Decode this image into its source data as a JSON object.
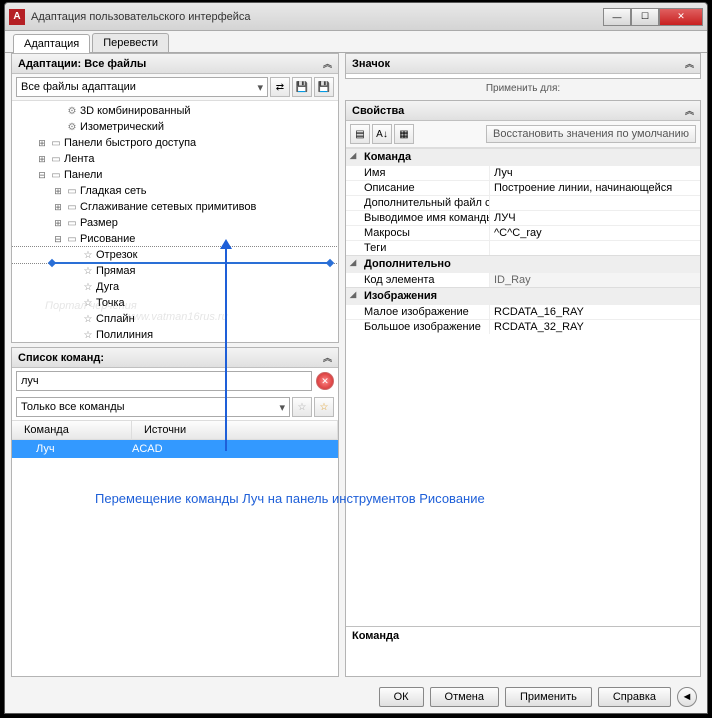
{
  "window": {
    "title": "Адаптация пользовательского интерфейса",
    "app_icon_letter": "A"
  },
  "tabs": {
    "adapt": "Адаптация",
    "translate": "Перевести"
  },
  "adaptations": {
    "header": "Адаптации: Все файлы",
    "combo": "Все файлы адаптации",
    "tree": {
      "combined3d": "3D комбинированный",
      "isometric": "Изометрический",
      "quickaccess": "Панели быстрого доступа",
      "ribbon": "Лента",
      "panels": "Панели",
      "smoothmesh": "Гладкая сеть",
      "netprimitives": "Сглаживание сетевых примитивов",
      "dimension": "Размер",
      "draw": "Рисование",
      "segment": "Отрезок",
      "line": "Прямая",
      "arc": "Дуга",
      "point": "Точка",
      "spline": "Сплайн",
      "polyline": "Полилиния"
    }
  },
  "commandlist": {
    "header": "Список команд:",
    "search_value": "луч",
    "filter": "Только все команды",
    "col_cmd": "Команда",
    "col_src": "Источни",
    "row_cmd": "Луч",
    "row_src": "ACAD"
  },
  "iconpanel": {
    "header": "Значок",
    "apply_for": "Применить для:"
  },
  "properties": {
    "header": "Свойства",
    "restore": "Восстановить значения по умолчанию",
    "cat_command": "Команда",
    "name_k": "Имя",
    "name_v": "Луч",
    "desc_k": "Описание",
    "desc_v": "Построение линии, начинающейся",
    "addfile_k": "Дополнительный файл спр:",
    "addfile_v": "",
    "cmdname_k": "Выводимое имя команды",
    "cmdname_v": "ЛУЧ",
    "macros_k": "Макросы",
    "macros_v": "^C^C_ray",
    "tags_k": "Теги",
    "tags_v": "",
    "cat_extra": "Дополнительно",
    "elemcode_k": "Код элемента",
    "elemcode_v": "ID_Ray",
    "cat_images": "Изображения",
    "small_k": "Малое изображение",
    "small_v": "RCDATA_16_RAY",
    "large_k": "Большое изображение",
    "large_v": "RCDATA_32_RAY",
    "desc_header": "Команда"
  },
  "footer": {
    "ok": "ОК",
    "cancel": "Отмена",
    "apply": "Применить",
    "help": "Справка"
  },
  "annotation": "Перемещение команды Луч на панель инструментов Рисование",
  "watermark1": "Портал черчения",
  "watermark2": "www.vatman16rus.ru"
}
